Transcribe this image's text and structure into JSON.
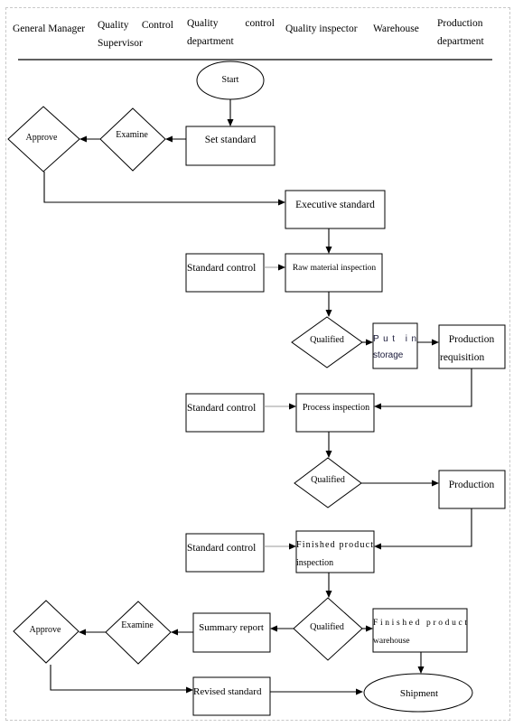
{
  "lanes": [
    {
      "id": "general-manager",
      "label_lines": [
        "General Manager"
      ]
    },
    {
      "id": "quality-control-supervisor",
      "label_lines": [
        "Quality Control",
        "Supervisor"
      ]
    },
    {
      "id": "quality-control-department",
      "label_lines": [
        "Quality control",
        "department"
      ]
    },
    {
      "id": "quality-inspector",
      "label_lines": [
        "Quality inspector"
      ]
    },
    {
      "id": "warehouse",
      "label_lines": [
        "Warehouse"
      ]
    },
    {
      "id": "production-department",
      "label_lines": [
        "Production",
        "department"
      ]
    }
  ],
  "nodes": {
    "start": "Start",
    "approve_top": "Approve",
    "examine_top": "Examine",
    "set_standard": "Set standard",
    "executive_standard": "Executive standard",
    "standard_control_1": "Standard control",
    "raw_material_inspection": "Raw material inspection",
    "qualified_1": "Qualified",
    "put_in_storage": [
      "Put in",
      "storage"
    ],
    "production_requisition": [
      "Production",
      "requisition"
    ],
    "standard_control_2": "Standard control",
    "process_inspection": "Process inspection",
    "qualified_2": "Qualified",
    "production": "Production",
    "standard_control_3": "Standard control",
    "finished_product_inspection": [
      "Finished product",
      "inspection"
    ],
    "qualified_3": "Qualified",
    "approve_bottom": "Approve",
    "examine_bottom": "Examine",
    "summary_report": "Summary report",
    "finished_product_warehouse": [
      "Finished product",
      "warehouse"
    ],
    "revised_standard": "Revised standard",
    "shipment": "Shipment"
  },
  "colors": {
    "stroke": "#000000",
    "gray_connector": "#9a9a9a",
    "frame": "#c8c8c8",
    "storage_text": "#1a1a3a"
  }
}
